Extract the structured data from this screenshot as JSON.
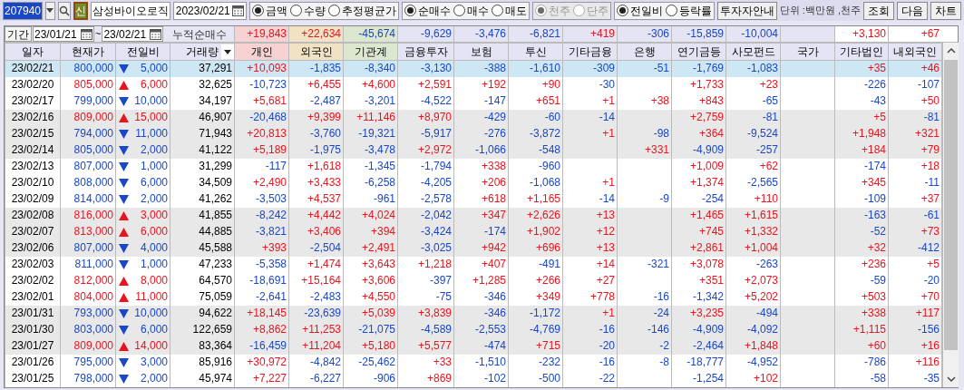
{
  "toolbar": {
    "code": "207940",
    "badge": "신",
    "stock_name": "삼성바이오로직",
    "date": "2023/02/21",
    "radio_groups": [
      {
        "disabled": false,
        "options": [
          {
            "label": "금액",
            "selected": true
          },
          {
            "label": "수량",
            "selected": false
          },
          {
            "label": "추정평균가",
            "selected": false
          }
        ]
      },
      {
        "disabled": false,
        "options": [
          {
            "label": "순매수",
            "selected": true
          },
          {
            "label": "매수",
            "selected": false
          },
          {
            "label": "매도",
            "selected": false
          }
        ]
      },
      {
        "disabled": true,
        "options": [
          {
            "label": "천주",
            "selected": true
          },
          {
            "label": "단주",
            "selected": false
          }
        ]
      },
      {
        "disabled": false,
        "options": [
          {
            "label": "전일비",
            "selected": true
          },
          {
            "label": "등락률",
            "selected": false
          }
        ]
      }
    ],
    "guide_button": "투자자안내",
    "unit": "단위 :백만원 ,천주",
    "buttons": [
      "조회",
      "다음",
      "차트"
    ]
  },
  "period": {
    "label": "기간",
    "from": "23/01/21",
    "separator": "~",
    "to": "23/02/21",
    "total_label": "누적순매수"
  },
  "totals": {
    "individual": {
      "value": "+19,843",
      "color": "#f6d2d2"
    },
    "foreign": {
      "value": "+22,634",
      "color": "#f2e2c4"
    },
    "institutions": {
      "value": "-45,674",
      "color": "#dbe8cf"
    },
    "financial_investment": {
      "value": "-9,629",
      "color": "#e4e4f4"
    },
    "insurance": {
      "value": "-3,476",
      "color": "#e4e4f4"
    },
    "investment_trust": {
      "value": "-6,821",
      "color": "#e4e4f4"
    },
    "other_finance": {
      "value": "+419",
      "color": "#e4e4f4"
    },
    "bank": {
      "value": "-306",
      "color": "#e4e4f4"
    },
    "pension": {
      "value": "-15,859",
      "color": "#e4e4f4"
    },
    "private_fund": {
      "value": "-10,004",
      "color": "#e4e4f4"
    },
    "other_corp": {
      "value": "+3,130",
      "color": "#ffffff"
    },
    "domestic_foreign": {
      "value": "+67",
      "color": "#ffffff"
    }
  },
  "columns": [
    {
      "label": "일자",
      "color": "#e4e4f4"
    },
    {
      "label": "현재가",
      "color": "#e4e4f4"
    },
    {
      "label": "전일비",
      "color": "#e4e4f4"
    },
    {
      "label": "거래량",
      "color": "#e4e4f4"
    },
    {
      "label": "개인",
      "color": "#f6d2d2"
    },
    {
      "label": "외국인",
      "color": "#f2e2c4"
    },
    {
      "label": "기관계",
      "color": "#dbe8cf"
    },
    {
      "label": "금융투자",
      "color": "#e4e4f4"
    },
    {
      "label": "보험",
      "color": "#e4e4f4"
    },
    {
      "label": "투신",
      "color": "#e4e4f4"
    },
    {
      "label": "기타금융",
      "color": "#e4e4f4"
    },
    {
      "label": "은행",
      "color": "#e4e4f4"
    },
    {
      "label": "연기금등",
      "color": "#e4e4f4"
    },
    {
      "label": "사모펀드",
      "color": "#e4e4f4"
    },
    {
      "label": "국가",
      "color": "#e4e4f4"
    },
    {
      "label": "기타법인",
      "color": "#e4e4f4"
    },
    {
      "label": "내외국인",
      "color": "#e4e4f4"
    }
  ],
  "rows": [
    {
      "date": "23/02/21",
      "price": "800,000",
      "rising": false,
      "change": "5,000",
      "volume": "37,291",
      "selected": true,
      "flows": {
        "individual": "+10,093",
        "foreign": "-1,835",
        "institutions": "-8,340",
        "financial_investment": "-3,130",
        "insurance": "-388",
        "investment_trust": "-1,610",
        "other_finance": "-309",
        "bank": "-51",
        "pension": "-1,769",
        "private_fund": "-1,083",
        "other_corp": "+35",
        "domestic_foreign": "+46"
      }
    },
    {
      "date": "23/02/20",
      "price": "805,000",
      "rising": true,
      "change": "6,000",
      "volume": "32,625",
      "shaded": false,
      "selected": false,
      "flows": {
        "individual": "-10,723",
        "foreign": "+6,455",
        "institutions": "+4,600",
        "financial_investment": "+2,591",
        "insurance": "+192",
        "investment_trust": "+90",
        "other_finance": "-30",
        "pension": "+1,733",
        "private_fund": "+23",
        "other_corp": "-226",
        "domestic_foreign": "-107"
      }
    },
    {
      "date": "23/02/17",
      "price": "799,000",
      "rising": false,
      "change": "10,000",
      "volume": "34,197",
      "shaded": false,
      "selected": false,
      "flows": {
        "individual": "+5,681",
        "foreign": "-2,487",
        "institutions": "-3,201",
        "financial_investment": "-4,522",
        "insurance": "-147",
        "investment_trust": "+651",
        "other_finance": "+1",
        "bank": "+38",
        "pension": "+843",
        "private_fund": "-65",
        "other_corp": "-43",
        "domestic_foreign": "+50"
      }
    },
    {
      "date": "23/02/16",
      "price": "809,000",
      "rising": true,
      "change": "15,000",
      "volume": "46,907",
      "shaded": true,
      "selected": false,
      "flows": {
        "individual": "-20,468",
        "foreign": "+9,399",
        "institutions": "+11,146",
        "financial_investment": "+8,970",
        "insurance": "-429",
        "investment_trust": "-60",
        "other_finance": "-14",
        "pension": "+2,759",
        "private_fund": "-81",
        "other_corp": "+5",
        "domestic_foreign": "-81"
      }
    },
    {
      "date": "23/02/15",
      "price": "794,000",
      "rising": false,
      "change": "11,000",
      "volume": "71,943",
      "shaded": true,
      "selected": false,
      "flows": {
        "individual": "+20,813",
        "foreign": "-3,760",
        "institutions": "-19,321",
        "financial_investment": "-5,917",
        "insurance": "-276",
        "investment_trust": "-3,872",
        "other_finance": "+1",
        "bank": "-98",
        "pension": "+364",
        "private_fund": "-9,524",
        "other_corp": "+1,948",
        "domestic_foreign": "+321"
      }
    },
    {
      "date": "23/02/14",
      "price": "805,000",
      "rising": false,
      "change": "2,000",
      "volume": "41,122",
      "shaded": true,
      "selected": false,
      "flows": {
        "individual": "+5,189",
        "foreign": "-1,975",
        "institutions": "-3,478",
        "financial_investment": "+2,972",
        "insurance": "-1,066",
        "investment_trust": "-548",
        "bank": "+331",
        "pension": "-4,909",
        "private_fund": "-257",
        "other_corp": "+184",
        "domestic_foreign": "+79"
      }
    },
    {
      "date": "23/02/13",
      "price": "807,000",
      "rising": false,
      "change": "1,000",
      "volume": "31,299",
      "shaded": false,
      "selected": false,
      "flows": {
        "individual": "-117",
        "foreign": "+1,618",
        "institutions": "-1,345",
        "financial_investment": "-1,794",
        "insurance": "+338",
        "investment_trust": "-960",
        "pension": "+1,009",
        "private_fund": "+62",
        "other_corp": "-174",
        "domestic_foreign": "+18"
      }
    },
    {
      "date": "23/02/10",
      "price": "808,000",
      "rising": false,
      "change": "6,000",
      "volume": "34,509",
      "shaded": false,
      "selected": false,
      "flows": {
        "individual": "+2,490",
        "foreign": "+3,433",
        "institutions": "-6,258",
        "financial_investment": "-4,205",
        "insurance": "+206",
        "investment_trust": "-1,068",
        "other_finance": "+1",
        "pension": "+1,374",
        "private_fund": "-2,565",
        "other_corp": "+345",
        "domestic_foreign": "-11"
      }
    },
    {
      "date": "23/02/09",
      "price": "814,000",
      "rising": false,
      "change": "2,000",
      "volume": "41,262",
      "shaded": false,
      "selected": false,
      "flows": {
        "individual": "-3,503",
        "foreign": "+4,537",
        "institutions": "-961",
        "financial_investment": "-2,578",
        "insurance": "+618",
        "investment_trust": "+1,165",
        "other_finance": "-14",
        "bank": "-9",
        "pension": "-254",
        "private_fund": "+110",
        "other_corp": "-109",
        "domestic_foreign": "+37"
      }
    },
    {
      "date": "23/02/08",
      "price": "816,000",
      "rising": true,
      "change": "3,000",
      "volume": "41,855",
      "shaded": true,
      "selected": false,
      "flows": {
        "individual": "-8,242",
        "foreign": "+4,442",
        "institutions": "+4,024",
        "financial_investment": "-2,042",
        "insurance": "+347",
        "investment_trust": "+2,626",
        "other_finance": "+13",
        "pension": "+1,465",
        "private_fund": "+1,615",
        "other_corp": "-163",
        "domestic_foreign": "-61"
      }
    },
    {
      "date": "23/02/07",
      "price": "813,000",
      "rising": true,
      "change": "6,000",
      "volume": "44,885",
      "shaded": true,
      "selected": false,
      "flows": {
        "individual": "-3,821",
        "foreign": "+3,406",
        "institutions": "+394",
        "financial_investment": "-3,424",
        "insurance": "-174",
        "investment_trust": "+1,902",
        "other_finance": "+12",
        "pension": "+745",
        "private_fund": "+1,332",
        "other_corp": "-52",
        "domestic_foreign": "+73"
      }
    },
    {
      "date": "23/02/06",
      "price": "807,000",
      "rising": false,
      "change": "4,000",
      "volume": "45,588",
      "shaded": true,
      "selected": false,
      "flows": {
        "individual": "+393",
        "foreign": "-2,504",
        "institutions": "+2,491",
        "financial_investment": "-3,025",
        "insurance": "+942",
        "investment_trust": "+696",
        "other_finance": "+13",
        "pension": "+2,861",
        "private_fund": "+1,004",
        "other_corp": "+32",
        "domestic_foreign": "-412"
      }
    },
    {
      "date": "23/02/03",
      "price": "811,000",
      "rising": false,
      "change": "1,000",
      "volume": "47,233",
      "shaded": false,
      "selected": false,
      "flows": {
        "individual": "-5,358",
        "foreign": "+1,474",
        "institutions": "+3,643",
        "financial_investment": "+1,218",
        "insurance": "+407",
        "investment_trust": "-491",
        "other_finance": "+14",
        "bank": "-321",
        "pension": "+3,078",
        "private_fund": "-263",
        "other_corp": "+236",
        "domestic_foreign": "+5"
      }
    },
    {
      "date": "23/02/02",
      "price": "812,000",
      "rising": true,
      "change": "8,000",
      "volume": "64,570",
      "shaded": false,
      "selected": false,
      "flows": {
        "individual": "-18,691",
        "foreign": "+15,164",
        "institutions": "+3,606",
        "financial_investment": "-397",
        "insurance": "+1,285",
        "investment_trust": "+266",
        "other_finance": "+27",
        "pension": "+351",
        "private_fund": "+2,073",
        "other_corp": "-59",
        "domestic_foreign": "-20"
      }
    },
    {
      "date": "23/02/01",
      "price": "804,000",
      "rising": true,
      "change": "11,000",
      "volume": "75,059",
      "shaded": false,
      "selected": false,
      "flows": {
        "individual": "-2,641",
        "foreign": "-2,483",
        "institutions": "+4,550",
        "financial_investment": "-75",
        "insurance": "-346",
        "investment_trust": "+349",
        "other_finance": "+778",
        "bank": "-16",
        "pension": "-1,342",
        "private_fund": "+5,202",
        "other_corp": "+503",
        "domestic_foreign": "+70"
      }
    },
    {
      "date": "23/01/31",
      "price": "793,000",
      "rising": false,
      "change": "10,000",
      "volume": "94,622",
      "shaded": true,
      "selected": false,
      "flows": {
        "individual": "+18,145",
        "foreign": "-23,639",
        "institutions": "+5,039",
        "financial_investment": "+3,839",
        "insurance": "-346",
        "investment_trust": "-1,172",
        "other_finance": "+1",
        "bank": "-24",
        "pension": "+3,235",
        "private_fund": "-494",
        "other_corp": "+338",
        "domestic_foreign": "+117"
      }
    },
    {
      "date": "23/01/30",
      "price": "803,000",
      "rising": false,
      "change": "6,000",
      "volume": "122,659",
      "shaded": true,
      "selected": false,
      "flows": {
        "individual": "+8,862",
        "foreign": "+11,253",
        "institutions": "-21,075",
        "financial_investment": "-4,589",
        "insurance": "-2,553",
        "investment_trust": "-4,769",
        "other_finance": "-16",
        "bank": "-146",
        "pension": "-4,909",
        "private_fund": "-4,092",
        "other_corp": "+1,115",
        "domestic_foreign": "-156"
      }
    },
    {
      "date": "23/01/27",
      "price": "809,000",
      "rising": true,
      "change": "14,000",
      "volume": "83,364",
      "shaded": true,
      "selected": false,
      "flows": {
        "individual": "-16,459",
        "foreign": "+11,204",
        "institutions": "+5,180",
        "financial_investment": "+5,577",
        "insurance": "-474",
        "investment_trust": "+715",
        "other_finance": "-20",
        "bank": "-2",
        "pension": "-2,464",
        "private_fund": "+1,848",
        "other_corp": "+60",
        "domestic_foreign": "+16"
      }
    },
    {
      "date": "23/01/26",
      "price": "795,000",
      "rising": false,
      "change": "3,000",
      "volume": "85,916",
      "shaded": false,
      "selected": false,
      "flows": {
        "individual": "+30,972",
        "foreign": "-4,842",
        "institutions": "-25,462",
        "financial_investment": "+33",
        "insurance": "-1,510",
        "investment_trust": "-232",
        "other_finance": "-16",
        "bank": "-8",
        "pension": "-18,777",
        "private_fund": "-4,952",
        "other_corp": "-786",
        "domestic_foreign": "+116"
      }
    },
    {
      "date": "23/01/25",
      "price": "798,000",
      "rising": false,
      "change": "2,000",
      "volume": "45,974",
      "shaded": false,
      "selected": false,
      "flows": {
        "individual": "+7,227",
        "foreign": "-6,227",
        "institutions": "-906",
        "financial_investment": "+869",
        "insurance": "-102",
        "investment_trust": "-500",
        "other_finance": "-22",
        "pension": "-1,254",
        "private_fund": "+102",
        "other_corp": "-58",
        "domestic_foreign": "-35"
      }
    }
  ]
}
